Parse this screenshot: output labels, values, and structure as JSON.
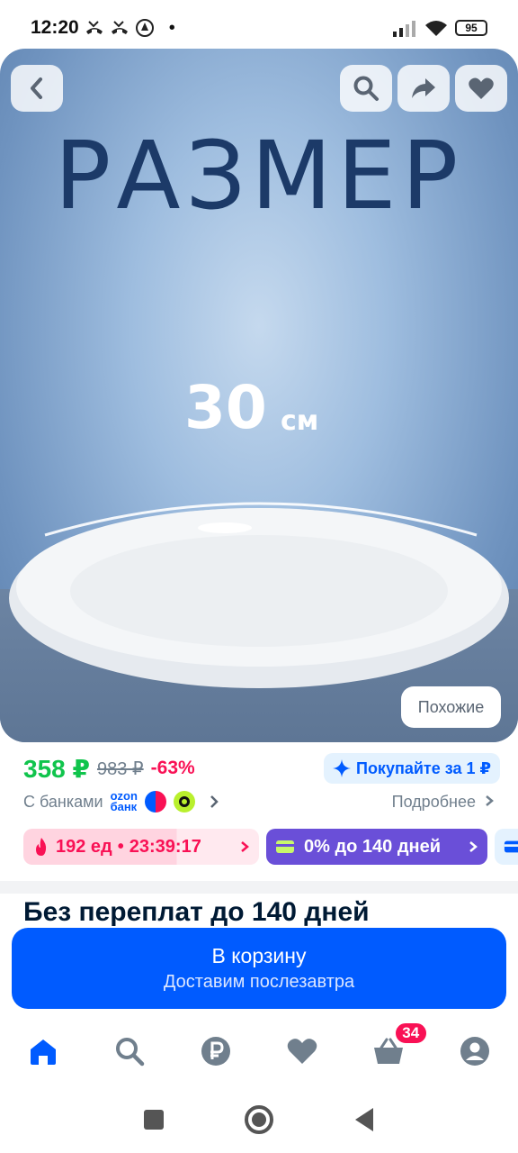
{
  "status_bar": {
    "time": "12:20",
    "battery": "95",
    "dot": "•"
  },
  "hero": {
    "title": "РАЗМЕР",
    "size_value": "30",
    "size_unit": "см",
    "similar_label": "Похожие",
    "icons": [
      "back-icon",
      "search-icon",
      "share-icon",
      "heart-icon"
    ]
  },
  "price": {
    "current": "358 ₽",
    "old": "983 ₽",
    "discount": "-63%",
    "buy_for": "Покупайте за 1 ₽"
  },
  "banks": {
    "label": "С банками",
    "ozon_line1": "ozon",
    "ozon_line2": "банк",
    "more": "Подробнее"
  },
  "chips": {
    "timer_qty": "192 ед",
    "timer_sep": "•",
    "timer_time": "23:39:17",
    "credit": "0% до 140 дней"
  },
  "section_title": "Без переплат до 140 дней",
  "cart_button": {
    "label": "В корзину",
    "sub": "Доставим послезавтра"
  },
  "tabbar": {
    "cart_count": "34",
    "items": [
      "home-icon",
      "search-icon",
      "ruble-icon",
      "heart-icon",
      "cart-icon",
      "profile-icon"
    ]
  },
  "colors": {
    "accent": "#005bff",
    "price_green": "#10c44c",
    "sale_pink": "#f91155",
    "credit_purple": "#6a4fd8"
  }
}
